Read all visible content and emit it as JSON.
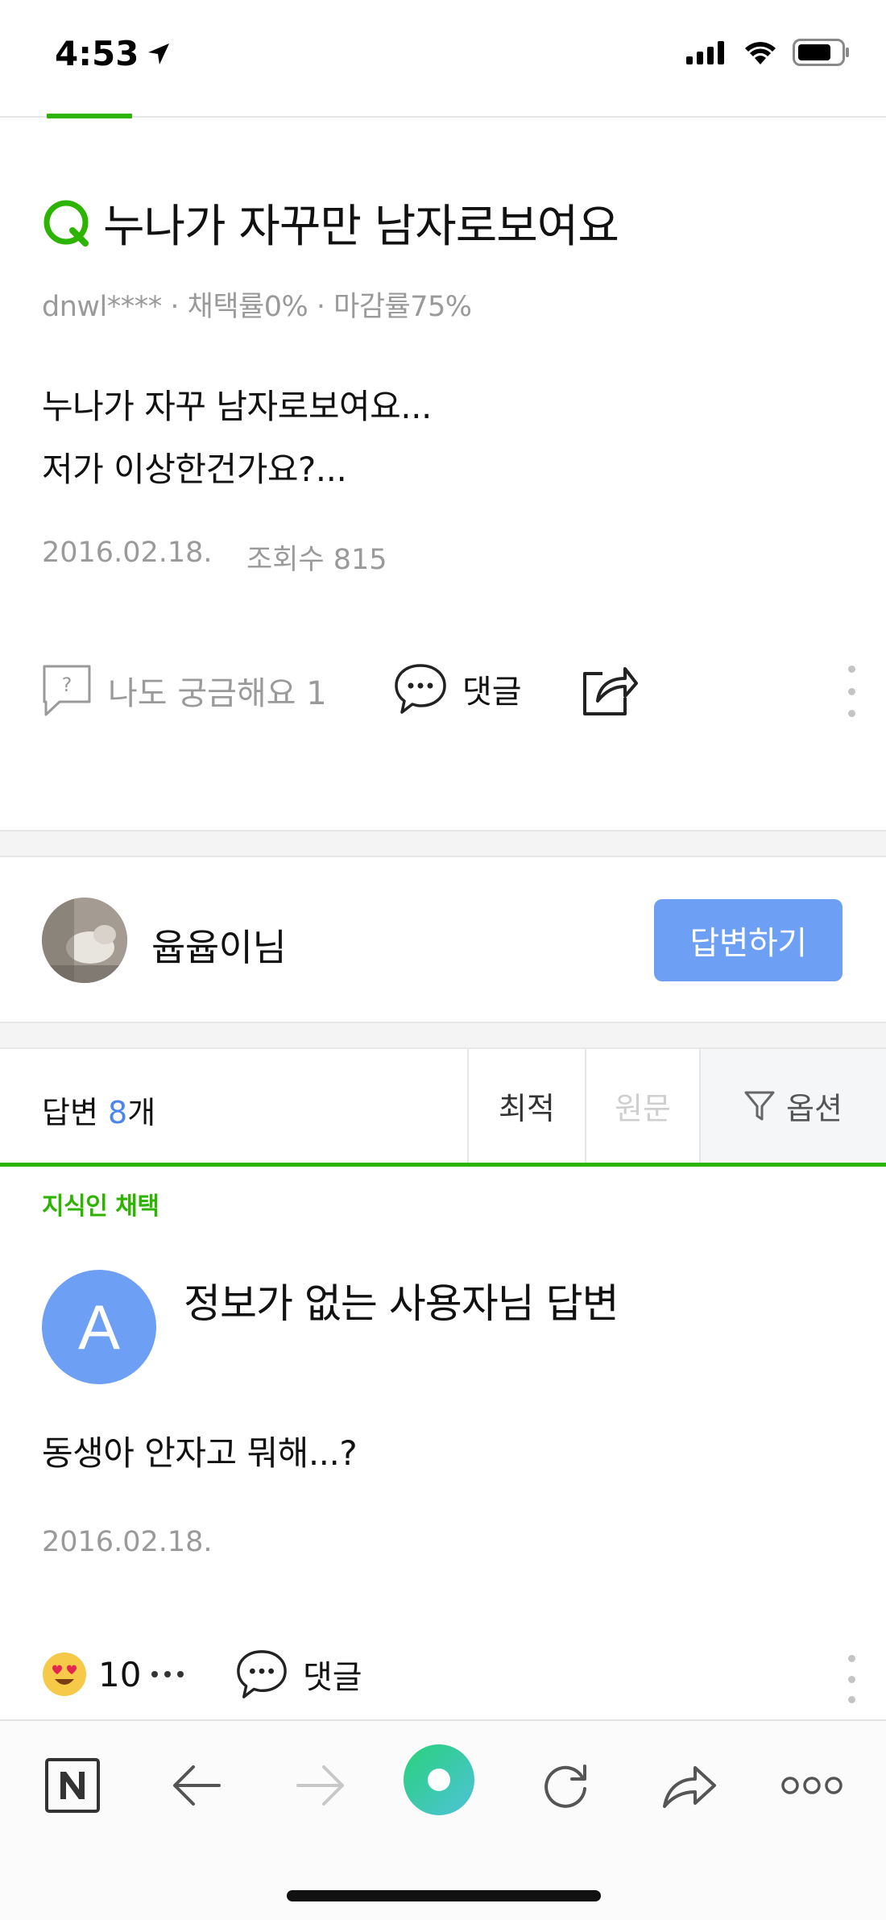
{
  "status_bar": {
    "time": "4:53"
  },
  "question": {
    "title": "누나가 자꾸만 남자로보여요",
    "meta": "dnwl**** · 채택률0% · 마감률75%",
    "body_line1": "누나가 자꾸 남자로보여요...",
    "body_line2": "저가 이상한건가요?...",
    "date": "2016.02.18.",
    "views": "조회수 815",
    "curious_label": "나도 궁금해요 1",
    "comment_label": "댓글"
  },
  "user": {
    "name": "윱윱이님",
    "answer_button": "답변하기"
  },
  "sort_bar": {
    "answer_prefix": "답변 ",
    "answer_count": "8",
    "answer_suffix": "개",
    "tab_best": "최적",
    "tab_original": "원문",
    "tab_option": "옵션"
  },
  "answer": {
    "adopted_label": "지식인 채택",
    "avatar_letter": "A",
    "author": "정보가 없는 사용자님 답변",
    "body": "동생아 안자고 뭐해...?",
    "date": "2016.02.18.",
    "reaction_count": "10",
    "comment_label": "댓글"
  },
  "colors": {
    "accent_green": "#2db400",
    "button_blue": "#6d9ff5",
    "count_blue": "#4a84f0"
  },
  "toolbar": {
    "icons": [
      "naver-home-icon",
      "back-arrow-icon",
      "forward-arrow-icon",
      "green-dot-icon",
      "refresh-icon",
      "share-icon",
      "more-icon"
    ]
  }
}
